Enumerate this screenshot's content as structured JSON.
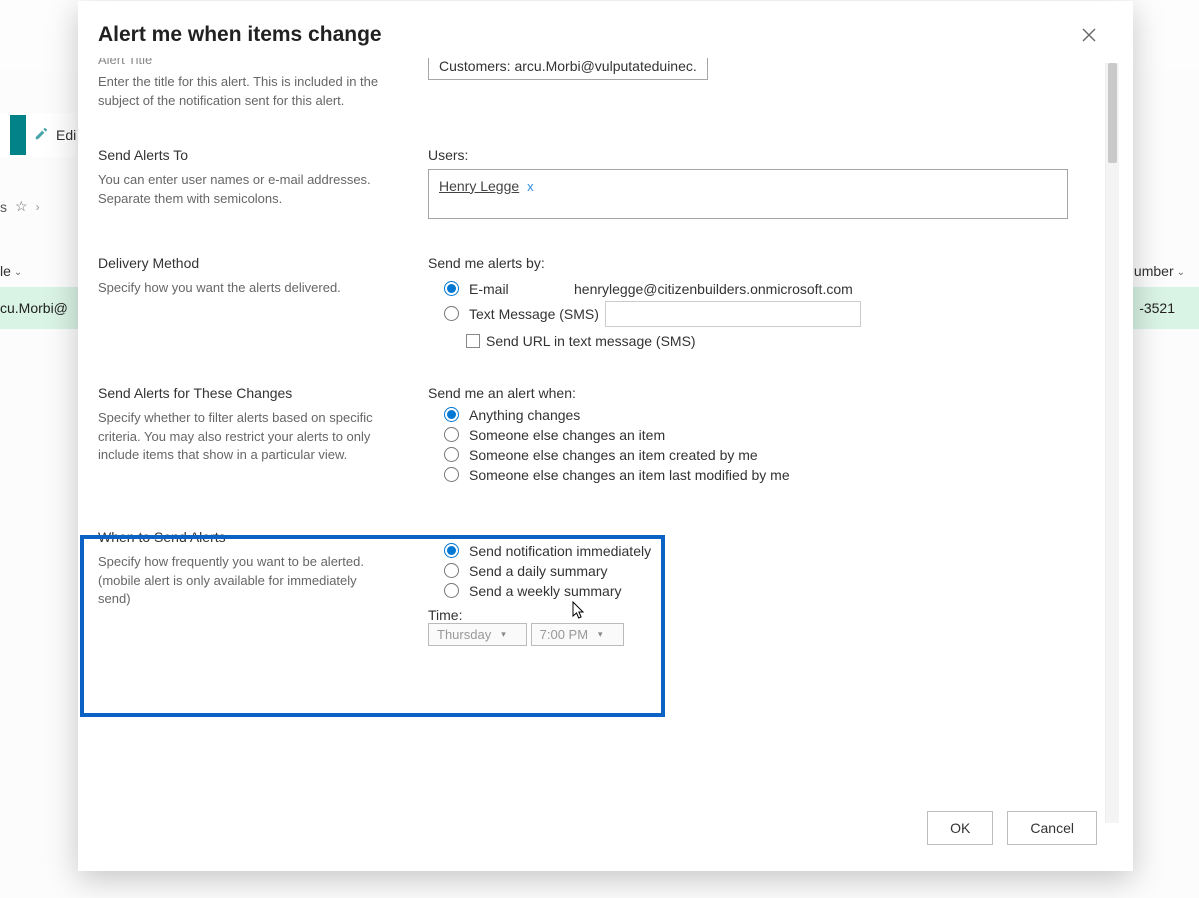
{
  "background": {
    "cmd_edit": "Edi",
    "breadcrumb_suffix": "s",
    "col_left": "le",
    "col_right": "umber",
    "row_left": "cu.Morbi@",
    "row_right": "-3521"
  },
  "modal": {
    "title": "Alert me when items change",
    "alert_title": {
      "heading": "Alert Title",
      "desc": "Enter the title for this alert. This is included in the subject of the notification sent for this alert.",
      "value": "Customers: arcu.Morbi@vulputateduinec."
    },
    "send_to": {
      "heading": "Send Alerts To",
      "desc": "You can enter user names or e-mail addresses. Separate them with semicolons.",
      "users_label": "Users:",
      "chip_name": "Henry Legge",
      "chip_remove": "x"
    },
    "delivery": {
      "heading": "Delivery Method",
      "desc": "Specify how you want the alerts delivered.",
      "label": "Send me alerts by:",
      "opt_email": "E-mail",
      "email_value": "henrylegge@citizenbuilders.onmicrosoft.com",
      "opt_sms": "Text Message (SMS)",
      "chk_url": "Send URL in text message (SMS)"
    },
    "changes": {
      "heading": "Send Alerts for These Changes",
      "desc": "Specify whether to filter alerts based on specific criteria. You may also restrict your alerts to only include items that show in a particular view.",
      "label": "Send me an alert when:",
      "opt1": "Anything changes",
      "opt2": "Someone else changes an item",
      "opt3": "Someone else changes an item created by me",
      "opt4": "Someone else changes an item last modified by me"
    },
    "when": {
      "heading": "When to Send Alerts",
      "desc1": "Specify how frequently you want to be alerted.",
      "desc2": "(mobile alert is only available for immediately send)",
      "opt1": "Send notification immediately",
      "opt2": "Send a daily summary",
      "opt3": "Send a weekly summary",
      "time_label": "Time:",
      "day": "Thursday",
      "hour": "7:00 PM"
    },
    "ok": "OK",
    "cancel": "Cancel"
  }
}
